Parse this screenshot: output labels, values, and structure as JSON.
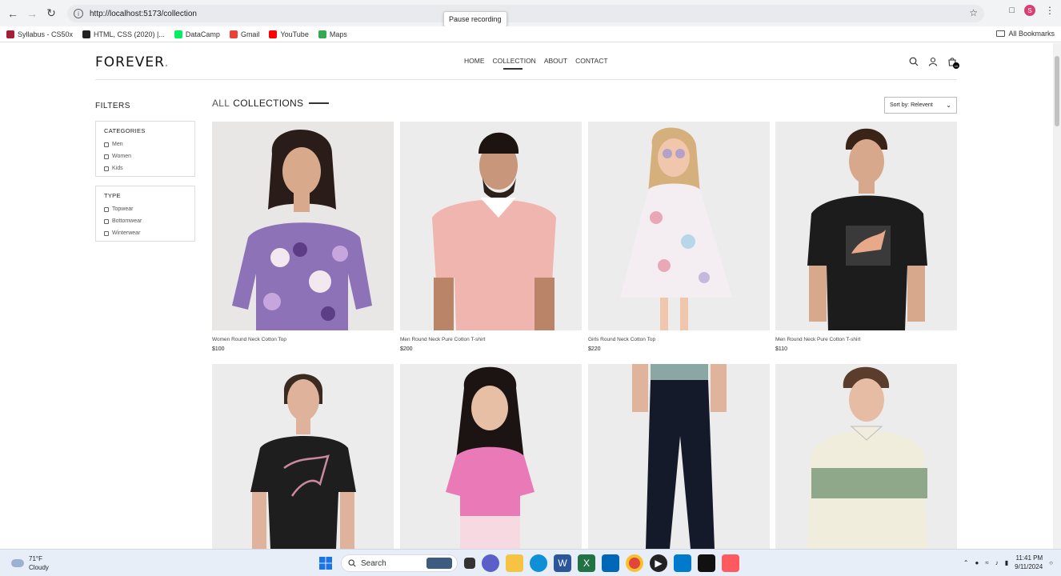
{
  "browser": {
    "url": "http://localhost:5173/collection",
    "tooltip": "Pause recording",
    "profile_initial": "S",
    "bookmarks": [
      {
        "label": "Syllabus - CS50x",
        "color": "#a41f35"
      },
      {
        "label": "HTML, CSS (2020) |...",
        "color": "#222222"
      },
      {
        "label": "DataCamp",
        "color": "#03ef62"
      },
      {
        "label": "Gmail",
        "color": "#ea4335"
      },
      {
        "label": "YouTube",
        "color": "#ff0000"
      },
      {
        "label": "Maps",
        "color": "#34a853"
      }
    ],
    "all_bookmarks": "All Bookmarks"
  },
  "site": {
    "logo": "FOREVER",
    "nav": [
      "HOME",
      "COLLECTION",
      "ABOUT",
      "CONTACT"
    ],
    "active_nav": "COLLECTION",
    "cart_count": "10"
  },
  "filters": {
    "title": "FILTERS",
    "categories": {
      "title": "CATEGORIES",
      "options": [
        "Men",
        "Women",
        "Kids"
      ]
    },
    "type": {
      "title": "TYPE",
      "options": [
        "Topwear",
        "Bottomwear",
        "Winterwear"
      ]
    }
  },
  "collection": {
    "title_prefix": "ALL",
    "title_main": "COLLECTIONS",
    "sort_label": "Sort by: Relevent"
  },
  "products": [
    {
      "name": "Women Round Neck Cotton Top",
      "price": "$100"
    },
    {
      "name": "Men Round Neck Pure Cotton T-shirt",
      "price": "$200"
    },
    {
      "name": "Girls Round Neck Cotton Top",
      "price": "$220"
    },
    {
      "name": "Men Round Neck Pure Cotton T-shirt",
      "price": "$110"
    },
    {
      "name": "",
      "price": ""
    },
    {
      "name": "",
      "price": ""
    },
    {
      "name": "",
      "price": ""
    },
    {
      "name": "",
      "price": ""
    }
  ],
  "taskbar": {
    "temp": "71°F",
    "weather": "Cloudy",
    "search": "Search",
    "time": "11:41 PM",
    "date": "9/11/2024"
  }
}
